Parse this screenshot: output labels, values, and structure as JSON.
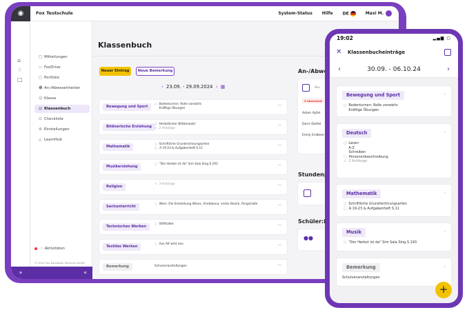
{
  "topbar": {
    "school_name": "Fox Testschule",
    "system_status": "System-Status",
    "help": "Hilfe",
    "language": "DE",
    "user_name": "Maxi M."
  },
  "sidenav": {
    "items": [
      {
        "label": "Mitteilungen",
        "icon": "message-icon"
      },
      {
        "label": "FoxDrive",
        "icon": "folder-icon"
      },
      {
        "label": "Portfolio",
        "icon": "portfolio-icon"
      },
      {
        "label": "An-/Abwesenheiten",
        "icon": "person-check-icon"
      },
      {
        "label": "Klasse",
        "icon": "group-icon"
      },
      {
        "label": "Klassenbuch",
        "icon": "book-icon"
      },
      {
        "label": "Checkliste",
        "icon": "checklist-icon"
      },
      {
        "label": "Einstellungen",
        "icon": "gear-icon"
      },
      {
        "label": "LearnHub",
        "icon": "graduation-icon"
      }
    ],
    "activity": "Aktivitäten",
    "copyright": "© 2024 Fox Education Services GmbH"
  },
  "main": {
    "title": "Klassenbuch",
    "new_entry": "Neuer Eintrag",
    "new_remark": "Neue Bemerkung",
    "date_range": "23.09. - 29.09.2024",
    "lessons": [
      {
        "subject": "Bewegung und Sport",
        "lines": [
          "Bodenturnen: Rolle vorwärts",
          "Kräftige Übungen"
        ],
        "attachments": ""
      },
      {
        "subject": "Bildnerische Erziehung",
        "lines": [
          "Herbstlicher Blätterwald"
        ],
        "attachments": "2 Anhänge"
      },
      {
        "subject": "Mathematik",
        "lines": [
          "Schriftliche Grundrechnungsarten",
          "A 19-23 & Aufgabenheft S.11"
        ],
        "attachments": ""
      },
      {
        "subject": "Musikerziehung",
        "lines": [
          "\"Der Herbst ist da\" Sim Sala Sing S.193"
        ],
        "attachments": ""
      },
      {
        "subject": "Religion",
        "lines": [],
        "attachments": "3 Anhänge"
      },
      {
        "subject": "Sachunterricht",
        "lines": [
          "Wien: Die Entstehung Wiens, Vindobona, erster Bezirk, Ringstraße"
        ],
        "attachments": ""
      },
      {
        "subject": "Technisches Werken",
        "lines": [
          "Stifthalter"
        ],
        "attachments": ""
      },
      {
        "subject": "Textiles Werken",
        "lines": [
          "Aus Alt wird neu"
        ],
        "attachments": ""
      },
      {
        "subject": "Bemerkung",
        "lines": [
          "Schulveranstaltungen"
        ],
        "attachments": ""
      }
    ]
  },
  "right_panel": {
    "absence_heading": "An-/Abwese",
    "new_label": "Neu",
    "absent_badge": "3 abwesend",
    "absent_people": [
      "Adam Apfel",
      "Doris Dattel",
      "Emily Erdbeer"
    ],
    "timetable_heading": "Stundenpla",
    "students_heading": "Schüler:inne"
  },
  "phone": {
    "time": "19:02",
    "title": "Klassenbucheinträge",
    "week": "30.09. - 06.10.24",
    "cards": [
      {
        "subject": "Bewegung und Sport",
        "lines": [
          "Bodenturnen: Rolle vorwärts",
          "Kräftige Übungen"
        ],
        "attachments": ""
      },
      {
        "subject": "Deutsch",
        "lines": [
          "Lesen",
          "A-Z",
          "Schreiben",
          "Personenbeschreibung"
        ],
        "attachments": "2 Anhänge"
      },
      {
        "subject": "Mathematik",
        "lines": [
          "Schriftliche Grundrechnungsarten",
          "A 19-23 & Aufgabenheft S.11"
        ],
        "attachments": ""
      },
      {
        "subject": "Musik",
        "lines": [
          "\"Der Herbst ist da\" Sim Sala Sing S.193"
        ],
        "attachments": ""
      },
      {
        "subject": "Bemerkung",
        "lines": [
          "Schulveranstaltungen"
        ],
        "attachments": ""
      }
    ]
  },
  "colors": {
    "brand_purple": "#7a3fbf",
    "accent_yellow": "#f2c200",
    "subject_tag_bg": "#efe9f8"
  }
}
